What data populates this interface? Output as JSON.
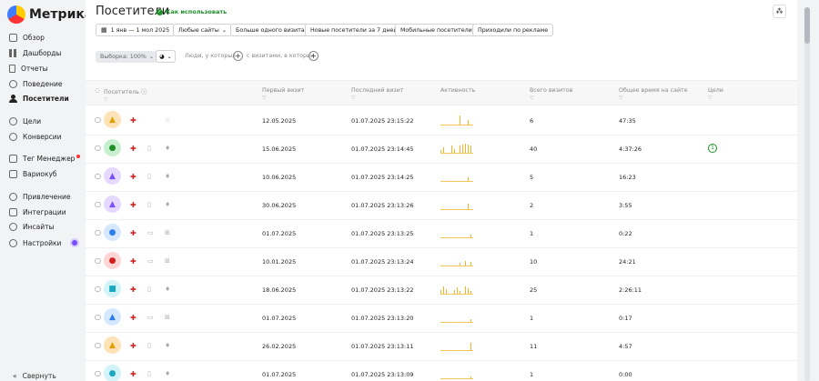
{
  "app": {
    "logo_text": "Метрика"
  },
  "sidebar": {
    "items": [
      {
        "label": "Обзор",
        "icon": "grid-icon"
      },
      {
        "label": "Дашборды",
        "icon": "dashboard-icon"
      },
      {
        "label": "Отчеты",
        "icon": "report-icon"
      },
      {
        "label": "Поведение",
        "icon": "behavior-icon"
      },
      {
        "label": "Посетители",
        "icon": "person-icon",
        "active": true
      },
      {
        "label": "Цели",
        "icon": "goal-icon"
      },
      {
        "label": "Конверсии",
        "icon": "conversion-icon"
      },
      {
        "label": "Тег Менеджер",
        "icon": "tag-icon",
        "badge": true
      },
      {
        "label": "Вариокуб",
        "icon": "variocube-icon"
      },
      {
        "label": "Привлечение",
        "icon": "acquisition-icon"
      },
      {
        "label": "Интеграции",
        "icon": "integration-icon"
      },
      {
        "label": "Инсайты",
        "icon": "insight-icon"
      },
      {
        "label": "Настройки",
        "icon": "settings-icon"
      }
    ],
    "collapse_label": "Свернуть"
  },
  "header": {
    "title": "Посетители",
    "howto": "Как использовать"
  },
  "filters": {
    "date_range": "1 янв — 1 мол 2025",
    "sites": "Любые сайты",
    "segments": [
      "Больше одного визита",
      "Новые посетители за 7 дней",
      "Мобильные посетители",
      "Приходили по рекламе"
    ]
  },
  "toolbar2": {
    "sample": "Выборка: 100%",
    "people_who": "Люди, у которых",
    "with_visits": "с визитами, в которых"
  },
  "table": {
    "columns": [
      "Посетитель",
      "Первый визит",
      "Последний визит",
      "Активность",
      "Всего визитов",
      "Общее время на сайте",
      "Цели"
    ],
    "rows": [
      {
        "first": "12.05.2025",
        "last": "01.07.2025 23:15:22",
        "visits": "6",
        "time": "47:35",
        "goals": "",
        "avatar_color": "#ffe3b8",
        "avatar_fg": "#e0a000",
        "avatar_glyph": "▲",
        "device": "",
        "os": "☆",
        "spark": [
          0,
          0,
          0,
          0,
          0,
          0,
          0,
          10,
          0,
          0,
          5,
          0
        ]
      },
      {
        "first": "15.06.2025",
        "last": "01.07.2025 23:14:45",
        "visits": "40",
        "time": "4:37:26",
        "goals": "1",
        "avatar_color": "#c8f0cf",
        "avatar_fg": "#1e8f2a",
        "avatar_glyph": "●",
        "device": "▯",
        "os": "♦",
        "spark": [
          3,
          6,
          0,
          0,
          8,
          4,
          0,
          8,
          9,
          10,
          9,
          8
        ]
      },
      {
        "first": "10.06.2025",
        "last": "01.07.2025 23:14:25",
        "visits": "5",
        "time": "16:23",
        "goals": "",
        "avatar_color": "#e6d9ff",
        "avatar_fg": "#7a4dff",
        "avatar_glyph": "▲",
        "device": "▯",
        "os": "♦",
        "spark": [
          0,
          0,
          0,
          0,
          0,
          0,
          0,
          0,
          0,
          0,
          4,
          0
        ]
      },
      {
        "first": "30.06.2025",
        "last": "01.07.2025 23:13:26",
        "visits": "2",
        "time": "3:55",
        "goals": "",
        "avatar_color": "#e6d9ff",
        "avatar_fg": "#7a4dff",
        "avatar_glyph": "▲",
        "device": "▯",
        "os": "♦",
        "spark": [
          0,
          0,
          0,
          0,
          0,
          0,
          0,
          0,
          0,
          0,
          6,
          0
        ]
      },
      {
        "first": "01.07.2025",
        "last": "01.07.2025 23:13:25",
        "visits": "1",
        "time": "0:22",
        "goals": "",
        "avatar_color": "#d6e8ff",
        "avatar_fg": "#2b7de9",
        "avatar_glyph": "●",
        "device": "▭",
        "os": "⊞",
        "spark": [
          0,
          0,
          0,
          0,
          0,
          0,
          0,
          0,
          0,
          0,
          0,
          3
        ]
      },
      {
        "first": "10.01.2025",
        "last": "01.07.2025 23:13:24",
        "visits": "10",
        "time": "24:21",
        "goals": "",
        "avatar_color": "#ffd6d6",
        "avatar_fg": "#d21f1f",
        "avatar_glyph": "●",
        "device": "▭",
        "os": "⊞",
        "spark": [
          0,
          0,
          0,
          0,
          0,
          0,
          0,
          3,
          0,
          5,
          0,
          4
        ]
      },
      {
        "first": "18.06.2025",
        "last": "01.07.2025 23:13:22",
        "visits": "25",
        "time": "2:26:11",
        "goals": "",
        "avatar_color": "#d2f3f7",
        "avatar_fg": "#1aa7c0",
        "avatar_glyph": "■",
        "device": "▯",
        "os": "♦",
        "spark": [
          4,
          8,
          5,
          0,
          0,
          4,
          7,
          3,
          0,
          8,
          6,
          3
        ]
      },
      {
        "first": "01.07.2025",
        "last": "01.07.2025 23:13:20",
        "visits": "1",
        "time": "0:17",
        "goals": "",
        "avatar_color": "#d6e8ff",
        "avatar_fg": "#2b7de9",
        "avatar_glyph": "▲",
        "device": "▭",
        "os": "⊞",
        "spark": [
          0,
          0,
          0,
          0,
          0,
          0,
          0,
          0,
          0,
          0,
          0,
          3
        ]
      },
      {
        "first": "26.02.2025",
        "last": "01.07.2025 23:13:11",
        "visits": "11",
        "time": "4:57",
        "goals": "",
        "avatar_color": "#ffe3b8",
        "avatar_fg": "#e0a000",
        "avatar_glyph": "▲",
        "device": "▯",
        "os": "♦",
        "spark": [
          0,
          0,
          0,
          0,
          0,
          0,
          0,
          0,
          0,
          0,
          0,
          8
        ]
      },
      {
        "first": "01.07.2025",
        "last": "01.07.2025 23:13:09",
        "visits": "1",
        "time": "0:00",
        "goals": "",
        "avatar_color": "#d2f3f7",
        "avatar_fg": "#1aa7c0",
        "avatar_glyph": "●",
        "device": "▯",
        "os": "♦",
        "spark": [
          0,
          0,
          0,
          0,
          0,
          0,
          0,
          0,
          0,
          0,
          0,
          2
        ]
      }
    ]
  }
}
